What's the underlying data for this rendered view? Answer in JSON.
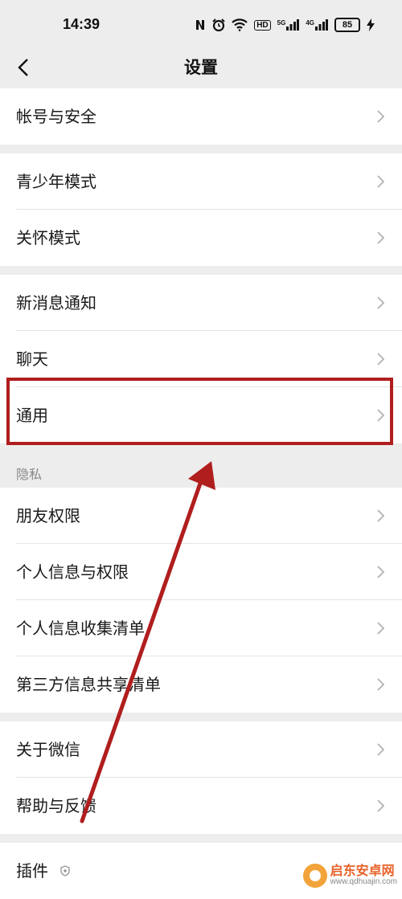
{
  "status_bar": {
    "time": "14:39",
    "icons": [
      "nfc-icon",
      "alarm-icon",
      "wifi-icon",
      "hd-icon",
      "signal-5g-icon",
      "signal-4g-icon"
    ],
    "hd_label": "HD",
    "signal1_label": "5G",
    "signal2_label": "4G",
    "battery": "85"
  },
  "nav": {
    "title": "设置"
  },
  "rows": {
    "account": "帐号与安全",
    "youth_mode": "青少年模式",
    "care_mode": "关怀模式",
    "notifications": "新消息通知",
    "chat": "聊天",
    "general": "通用",
    "friend_permissions": "朋友权限",
    "personal_info_permissions": "个人信息与权限",
    "personal_info_list": "个人信息收集清单",
    "third_party_list": "第三方信息共享清单",
    "about": "关于微信",
    "help": "帮助与反馈",
    "plugins": "插件"
  },
  "sections": {
    "privacy": "隐私"
  },
  "annotation": {
    "color": "#b01e1e"
  },
  "watermark": {
    "name": "启东安卓网",
    "url": "www.qdhuajin.com"
  }
}
